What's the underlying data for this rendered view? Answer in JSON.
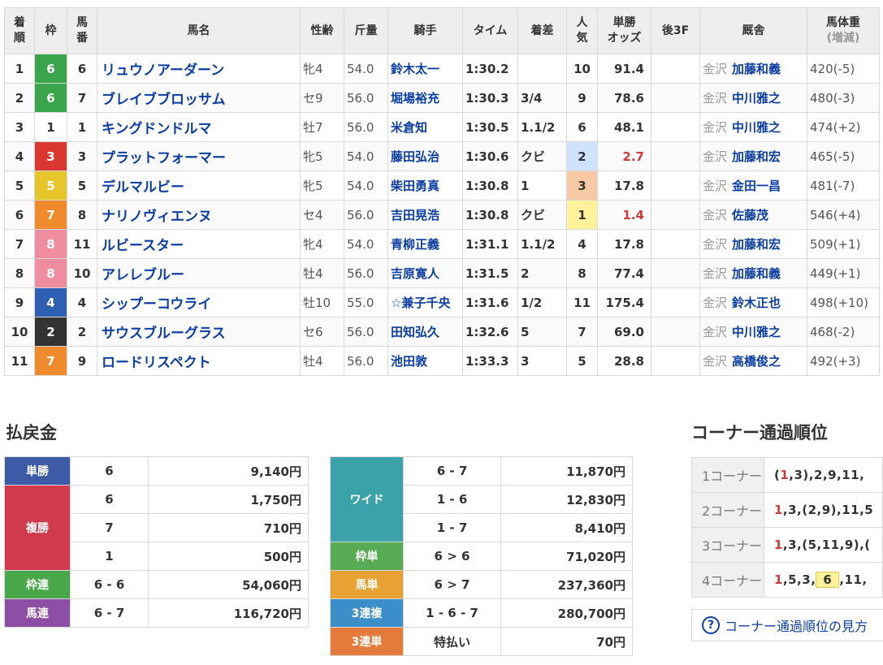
{
  "headers": {
    "rank": [
      "着",
      "順"
    ],
    "waku": "枠",
    "umaban": [
      "馬",
      "番"
    ],
    "name": "馬名",
    "sexage": "性齢",
    "weight": "斤量",
    "jockey": "騎手",
    "time": "タイム",
    "margin": "着差",
    "ninki": [
      "人",
      "気"
    ],
    "odds": [
      "単勝",
      "オッズ"
    ],
    "last3f": "後3F",
    "stable": "厩舎",
    "body": [
      "馬体重",
      "(増減)"
    ]
  },
  "colors": {
    "waku_1": "#ffffff",
    "waku_2": "#333333",
    "waku_3": "#d9372f",
    "waku_4": "#2f5fb3",
    "waku_5": "#e6c52a",
    "waku_6": "#3aa54a",
    "waku_7": "#ef8b2c",
    "waku_8": "#f08ca0"
  },
  "rows": [
    {
      "rank": "1",
      "waku": "6",
      "umaban": "6",
      "name": "リュウノアーダーン",
      "sexage": "牝4",
      "weight": "54.0",
      "jockey": "鈴木太一",
      "time": "1:30.2",
      "margin": "",
      "ninki": "10",
      "odds": "91.4",
      "last3f": "",
      "region": "金沢",
      "trainer": "加藤和義",
      "body": "420(-5)"
    },
    {
      "rank": "2",
      "waku": "6",
      "umaban": "7",
      "name": "ブレイブブロッサム",
      "sexage": "セ9",
      "weight": "56.0",
      "jockey": "堀場裕充",
      "time": "1:30.3",
      "margin": "3/4",
      "ninki": "9",
      "odds": "78.6",
      "last3f": "",
      "region": "金沢",
      "trainer": "中川雅之",
      "body": "480(-3)"
    },
    {
      "rank": "3",
      "waku": "1",
      "umaban": "1",
      "name": "キングドンドルマ",
      "sexage": "牡7",
      "weight": "56.0",
      "jockey": "米倉知",
      "time": "1:30.5",
      "margin": "1.1/2",
      "ninki": "6",
      "odds": "48.1",
      "last3f": "",
      "region": "金沢",
      "trainer": "中川雅之",
      "body": "474(+2)"
    },
    {
      "rank": "4",
      "waku": "3",
      "umaban": "3",
      "name": "プラットフォーマー",
      "sexage": "牝5",
      "weight": "54.0",
      "jockey": "藤田弘治",
      "time": "1:30.6",
      "margin": "クビ",
      "ninki": "2",
      "odds": "2.7",
      "last3f": "",
      "region": "金沢",
      "trainer": "加藤和宏",
      "body": "465(-5)"
    },
    {
      "rank": "5",
      "waku": "5",
      "umaban": "5",
      "name": "デルマルビー",
      "sexage": "牝5",
      "weight": "54.0",
      "jockey": "柴田勇真",
      "time": "1:30.8",
      "margin": "1",
      "ninki": "3",
      "odds": "17.8",
      "last3f": "",
      "region": "金沢",
      "trainer": "金田一昌",
      "body": "481(-7)"
    },
    {
      "rank": "6",
      "waku": "7",
      "umaban": "8",
      "name": "ナリノヴィエンヌ",
      "sexage": "セ4",
      "weight": "56.0",
      "jockey": "吉田晃浩",
      "time": "1:30.8",
      "margin": "クビ",
      "ninki": "1",
      "odds": "1.4",
      "last3f": "",
      "region": "金沢",
      "trainer": "佐藤茂",
      "body": "546(+4)"
    },
    {
      "rank": "7",
      "waku": "8",
      "umaban": "11",
      "name": "ルビースター",
      "sexage": "牝4",
      "weight": "54.0",
      "jockey": "青柳正義",
      "time": "1:31.1",
      "margin": "1.1/2",
      "ninki": "4",
      "odds": "17.8",
      "last3f": "",
      "region": "金沢",
      "trainer": "加藤和宏",
      "body": "509(+1)"
    },
    {
      "rank": "8",
      "waku": "8",
      "umaban": "10",
      "name": "アレレブルー",
      "sexage": "牡4",
      "weight": "56.0",
      "jockey": "吉原寛人",
      "time": "1:31.5",
      "margin": "2",
      "ninki": "8",
      "odds": "77.4",
      "last3f": "",
      "region": "金沢",
      "trainer": "加藤和義",
      "body": "449(+1)"
    },
    {
      "rank": "9",
      "waku": "4",
      "umaban": "4",
      "name": "シップーコウライ",
      "sexage": "牡10",
      "weight": "55.0",
      "jockey": "☆兼子千央",
      "time": "1:31.6",
      "margin": "1/2",
      "ninki": "11",
      "odds": "175.4",
      "last3f": "",
      "region": "金沢",
      "trainer": "鈴木正也",
      "body": "498(+10)"
    },
    {
      "rank": "10",
      "waku": "2",
      "umaban": "2",
      "name": "サウスブルーグラス",
      "sexage": "セ6",
      "weight": "56.0",
      "jockey": "田知弘久",
      "time": "1:32.6",
      "margin": "5",
      "ninki": "7",
      "odds": "69.0",
      "last3f": "",
      "region": "金沢",
      "trainer": "中川雅之",
      "body": "468(-2)"
    },
    {
      "rank": "11",
      "waku": "7",
      "umaban": "9",
      "name": "ロードリスペクト",
      "sexage": "牡4",
      "weight": "56.0",
      "jockey": "池田敦",
      "time": "1:33.3",
      "margin": "3",
      "ninki": "5",
      "odds": "28.8",
      "last3f": "",
      "region": "金沢",
      "trainer": "高橋俊之",
      "body": "492(+3)"
    }
  ],
  "payout_title": "払戻金",
  "corner_title": "コーナー通過順位",
  "payout_left": {
    "tansho": {
      "label": "単勝",
      "combo": "6",
      "amount": "9,140円"
    },
    "fukusho": {
      "label": "複勝",
      "entries": [
        {
          "combo": "6",
          "amount": "1,750円"
        },
        {
          "combo": "7",
          "amount": "710円"
        },
        {
          "combo": "1",
          "amount": "500円"
        }
      ]
    },
    "wakuren": {
      "label": "枠連",
      "combo": "6 - 6",
      "amount": "54,060円"
    },
    "umaren": {
      "label": "馬連",
      "combo": "6 - 7",
      "amount": "116,720円"
    }
  },
  "payout_right": {
    "wide": {
      "label": "ワイド",
      "entries": [
        {
          "combo": "6 - 7",
          "amount": "11,870円"
        },
        {
          "combo": "1 - 6",
          "amount": "12,830円"
        },
        {
          "combo": "1 - 7",
          "amount": "8,410円"
        }
      ]
    },
    "wakutan": {
      "label": "枠単",
      "combo": "6 > 6",
      "amount": "71,020円"
    },
    "umatan": {
      "label": "馬単",
      "combo": "6 > 7",
      "amount": "237,360円"
    },
    "sanrenpuku": {
      "label": "3連複",
      "combo": "1 - 6 - 7",
      "amount": "280,700円"
    },
    "sanrentan": {
      "label": "3連単",
      "combo": "特払い",
      "amount": "70円"
    }
  },
  "corners": [
    {
      "label": "1コーナー",
      "parts": [
        "(",
        "1",
        ",3),2,9,11,"
      ]
    },
    {
      "label": "2コーナー",
      "parts": [
        "",
        "1",
        ",3,(2,9),11,5"
      ]
    },
    {
      "label": "3コーナー",
      "parts": [
        "",
        "1",
        ",3,(5,11,9),("
      ]
    },
    {
      "label": "4コーナー",
      "parts": [
        "",
        "1",
        ",5,3,",
        "6",
        ",11,"
      ]
    }
  ],
  "help_text": "コーナー通過順位の見方"
}
